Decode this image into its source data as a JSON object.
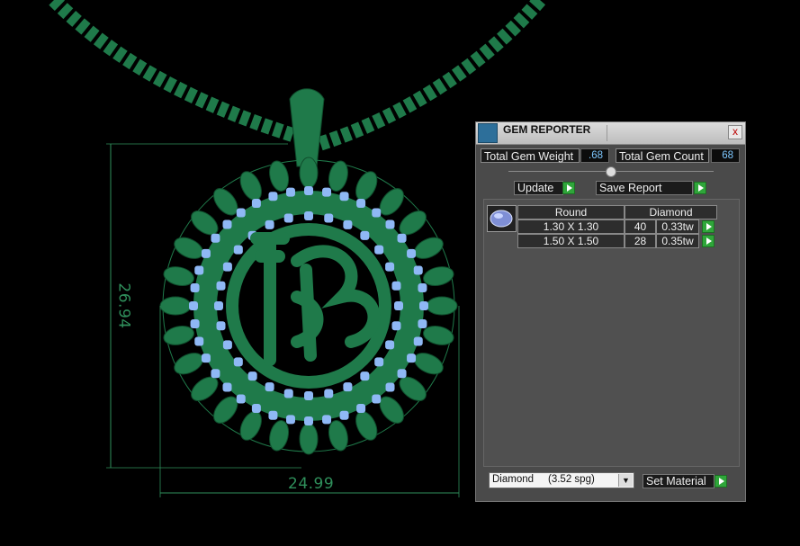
{
  "viewport": {
    "dimension_width": "24.99",
    "dimension_height": "26.94",
    "model_color": "#1f7a4a",
    "gem_color": "#8fb8f5"
  },
  "panel": {
    "title": "GEM REPORTER",
    "close_label": "x",
    "total_gem_weight_label": "Total Gem Weight",
    "total_gem_weight_value": ".68",
    "total_gem_count_label": "Total Gem Count",
    "total_gem_count_value": "68",
    "update_label": "Update",
    "save_report_label": "Save Report",
    "table": {
      "headers": [
        "Round",
        "Diamond"
      ],
      "rows": [
        {
          "size": "1.30 X 1.30",
          "count": "40",
          "weight": "0.33tw"
        },
        {
          "size": "1.50 X 1.50",
          "count": "28",
          "weight": "0.35tw"
        }
      ]
    },
    "material_name": "Diamond",
    "material_density": "(3.52 spg)",
    "set_material_label": "Set Material",
    "accent_color": "#2fa63a"
  }
}
